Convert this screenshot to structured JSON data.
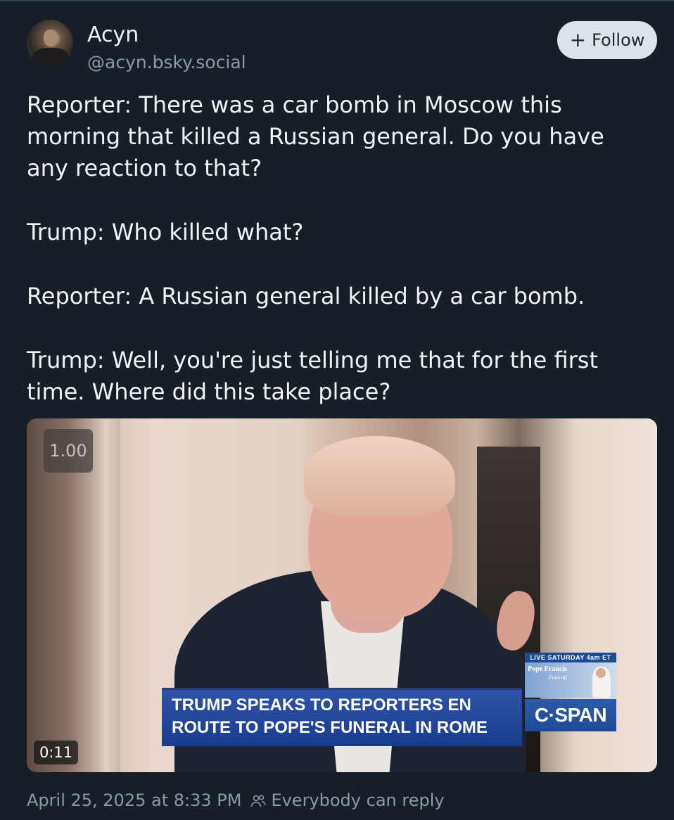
{
  "author": {
    "name": "Acyn",
    "handle": "@acyn.bsky.social"
  },
  "follow_button": {
    "icon": "plus-icon",
    "label": "Follow"
  },
  "post": {
    "lines": [
      "Reporter: There was a car bomb in Moscow this",
      "morning that killed a Russian general. Do you have",
      "any reaction to that?",
      "Trump: Who killed what?",
      "Reporter: A Russian general killed by a car bomb.",
      "Trump: Well, you're just telling me that for the first",
      "time. Where did this take place?"
    ]
  },
  "video": {
    "playback_speed": "1.00",
    "duration": "0:11",
    "lower_third": [
      "TRUMP SPEAKS TO REPORTERS EN",
      "ROUTE TO POPE'S FUNERAL IN ROME"
    ],
    "promo": {
      "top": "LIVE SATURDAY 4am ET",
      "title": "Pope Francis",
      "subtitle": "Funeral"
    },
    "network_logo": "C·SPAN"
  },
  "footer": {
    "timestamp": "April 25, 2025 at 8:33 PM",
    "reply_icon": "people-icon",
    "reply_setting": "Everybody can reply"
  },
  "colors": {
    "background": "#161e27",
    "muted_text": "#8c9aab",
    "follow_button_bg": "#dde3ea"
  }
}
